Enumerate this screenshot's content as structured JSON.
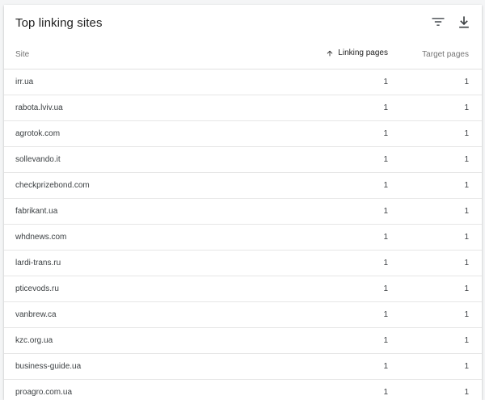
{
  "title": "Top linking sites",
  "columns": {
    "site": "Site",
    "linking_pages": "Linking pages",
    "target_pages": "Target pages"
  },
  "icons": {
    "filter": "filter-icon",
    "download": "download-icon",
    "sort": "arrow-up-icon"
  },
  "rows": [
    {
      "site": "irr.ua",
      "linking_pages": "1",
      "target_pages": "1"
    },
    {
      "site": "rabota.lviv.ua",
      "linking_pages": "1",
      "target_pages": "1"
    },
    {
      "site": "agrotok.com",
      "linking_pages": "1",
      "target_pages": "1"
    },
    {
      "site": "sollevando.it",
      "linking_pages": "1",
      "target_pages": "1"
    },
    {
      "site": "checkprizebond.com",
      "linking_pages": "1",
      "target_pages": "1"
    },
    {
      "site": "fabrikant.ua",
      "linking_pages": "1",
      "target_pages": "1"
    },
    {
      "site": "whdnews.com",
      "linking_pages": "1",
      "target_pages": "1"
    },
    {
      "site": "lardi-trans.ru",
      "linking_pages": "1",
      "target_pages": "1"
    },
    {
      "site": "pticevods.ru",
      "linking_pages": "1",
      "target_pages": "1"
    },
    {
      "site": "vanbrew.ca",
      "linking_pages": "1",
      "target_pages": "1"
    },
    {
      "site": "kzc.org.ua",
      "linking_pages": "1",
      "target_pages": "1"
    },
    {
      "site": "business-guide.ua",
      "linking_pages": "1",
      "target_pages": "1"
    },
    {
      "site": "proagro.com.ua",
      "linking_pages": "1",
      "target_pages": "1"
    }
  ]
}
